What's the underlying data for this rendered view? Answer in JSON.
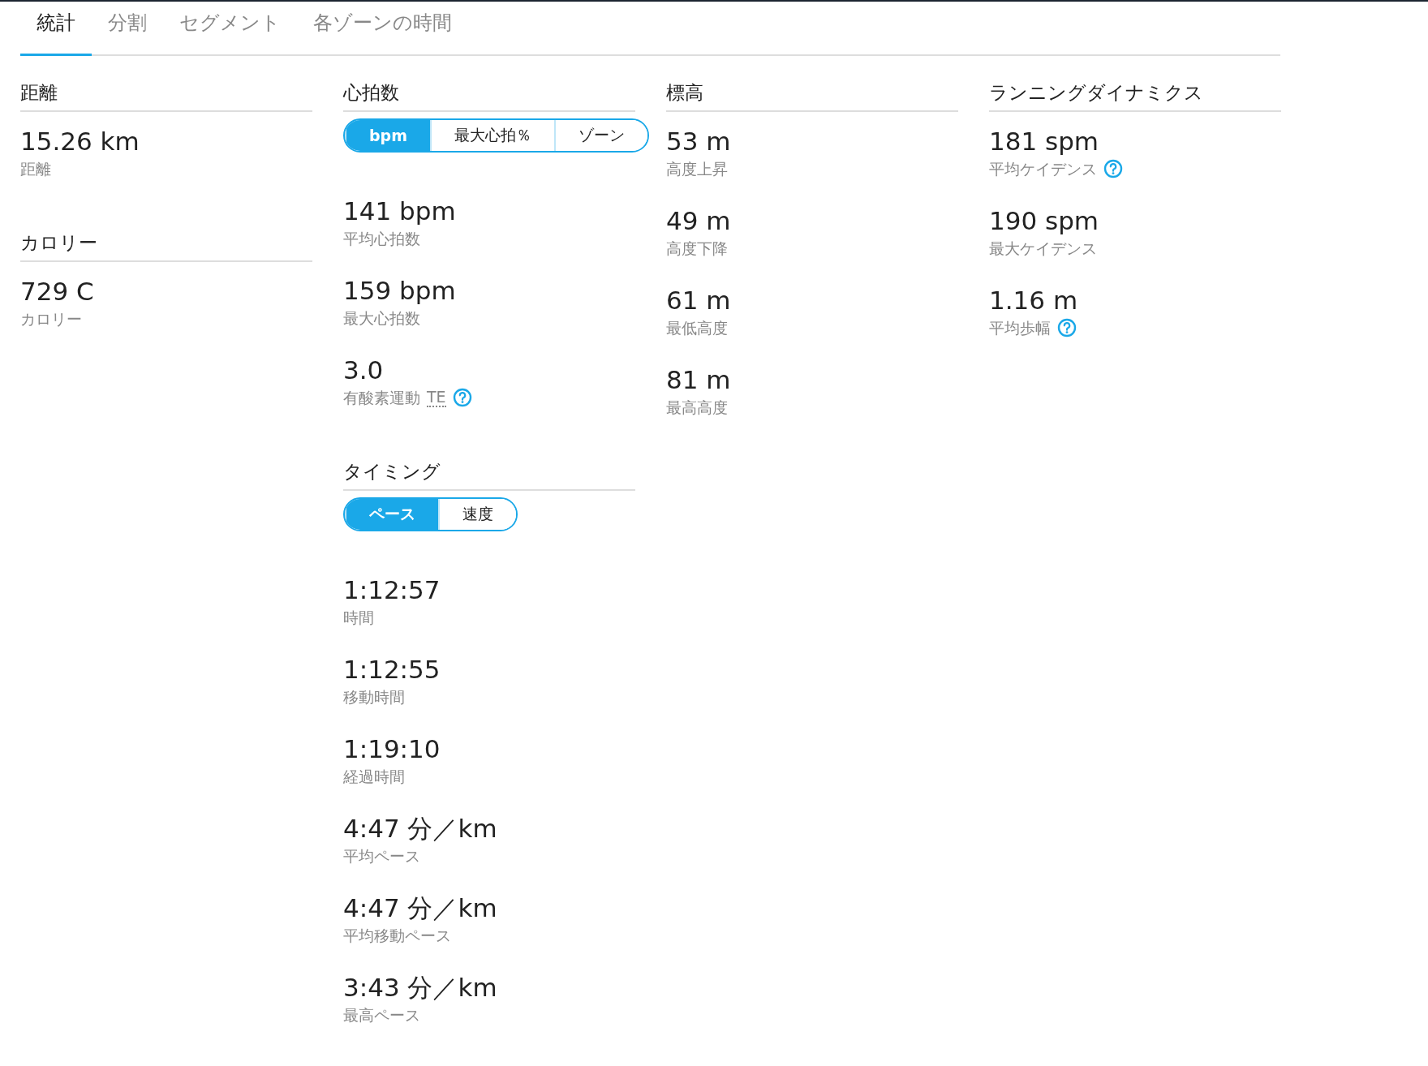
{
  "tabs": [
    {
      "label": "統計",
      "selected": true
    },
    {
      "label": "分割",
      "selected": false
    },
    {
      "label": "セグメント",
      "selected": false
    },
    {
      "label": "各ゾーンの時間",
      "selected": false
    }
  ],
  "columns": [
    {
      "sections": [
        {
          "title": "距離",
          "stats": [
            {
              "value": "15.26 km",
              "label": "距離",
              "help": false
            }
          ]
        },
        {
          "title": "カロリー",
          "stats": [
            {
              "value": "729 C",
              "label": "カロリー",
              "help": false
            }
          ]
        }
      ]
    },
    {
      "sections": [
        {
          "title": "心拍数",
          "toggle": [
            {
              "label": "bpm",
              "selected": true
            },
            {
              "label": "最大心拍％",
              "selected": false
            },
            {
              "label": "ゾーン",
              "selected": false
            }
          ],
          "stats": [
            {
              "value": "141 bpm",
              "label": "平均心拍数",
              "help": false
            },
            {
              "value": "159 bpm",
              "label": "最大心拍数",
              "help": false
            },
            {
              "value": "3.0",
              "label": "有酸素運動",
              "abbr": "TE",
              "help": true
            }
          ]
        },
        {
          "title": "タイミング",
          "toggle": [
            {
              "label": "ペース",
              "selected": true
            },
            {
              "label": "速度",
              "selected": false
            }
          ],
          "stats": [
            {
              "value": "1:12:57",
              "label": "時間",
              "help": false
            },
            {
              "value": "1:12:55",
              "label": "移動時間",
              "help": false
            },
            {
              "value": "1:19:10",
              "label": "経過時間",
              "help": false
            },
            {
              "value": "4:47 分／km",
              "label": "平均ペース",
              "help": false
            },
            {
              "value": "4:47 分／km",
              "label": "平均移動ペース",
              "help": false
            },
            {
              "value": "3:43 分／km",
              "label": "最高ペース",
              "help": false
            }
          ]
        }
      ]
    },
    {
      "sections": [
        {
          "title": "標高",
          "stats": [
            {
              "value": "53 m",
              "label": "高度上昇",
              "help": false
            },
            {
              "value": "49 m",
              "label": "高度下降",
              "help": false
            },
            {
              "value": "61 m",
              "label": "最低高度",
              "help": false
            },
            {
              "value": "81 m",
              "label": "最高高度",
              "help": false
            }
          ]
        }
      ]
    },
    {
      "sections": [
        {
          "title": "ランニングダイナミクス",
          "stats": [
            {
              "value": "181 spm",
              "label": "平均ケイデンス",
              "help": true
            },
            {
              "value": "190 spm",
              "label": "最大ケイデンス",
              "help": false
            },
            {
              "value": "1.16 m",
              "label": "平均歩幅",
              "help": true
            }
          ]
        }
      ]
    }
  ]
}
